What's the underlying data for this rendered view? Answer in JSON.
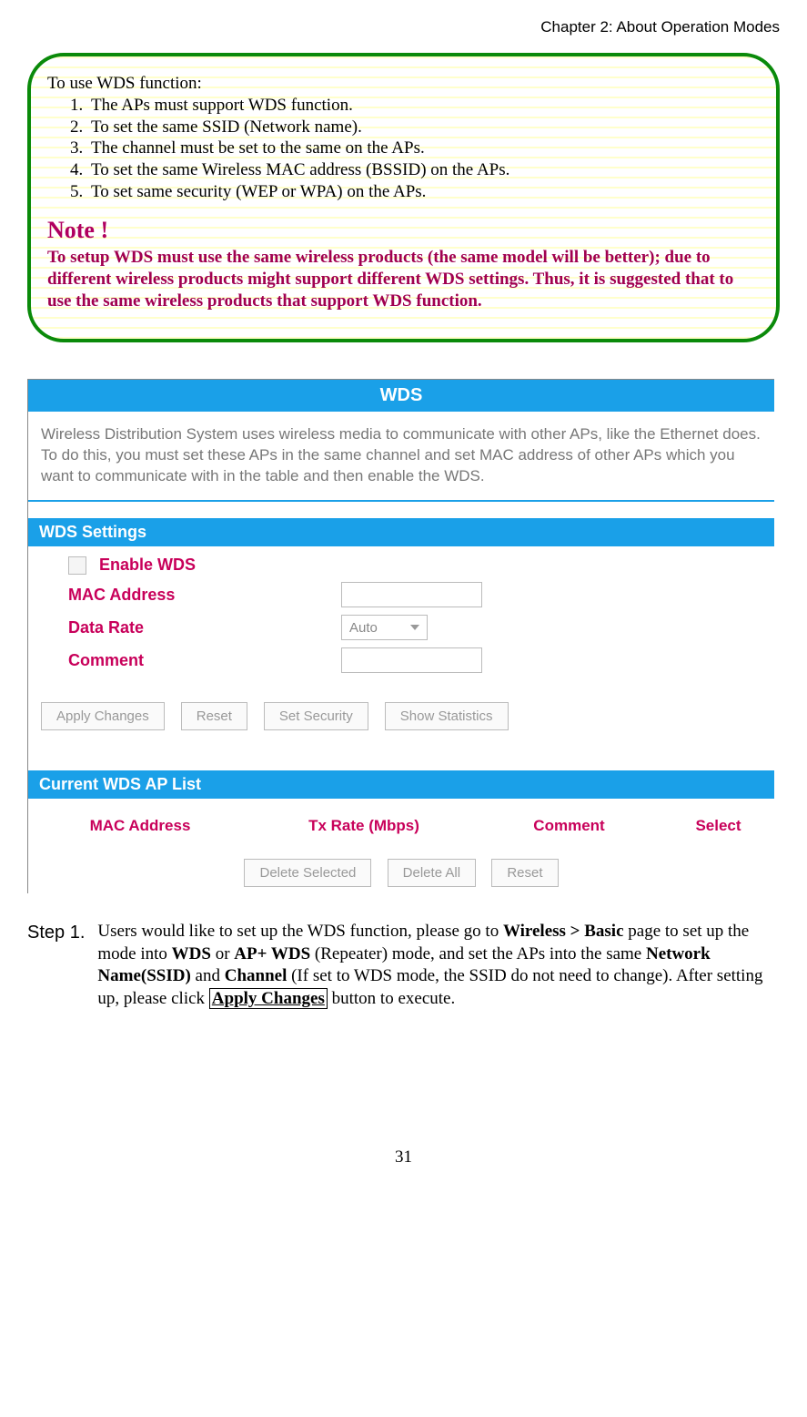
{
  "header": {
    "chapter": "Chapter 2: About Operation Modes"
  },
  "callout": {
    "intro": "To use WDS function:",
    "items": [
      "The APs must support WDS function.",
      "To set the same SSID (Network name).",
      "The channel  must be set to the same on the APs.",
      "To set the same Wireless MAC address (BSSID) on the APs.",
      "To set same security (WEP or WPA) on the APs."
    ],
    "note_title": "Note !",
    "note_body": "To setup WDS must use the same wireless products (the same model will be better); due to different wireless products might support different WDS settings. Thus, it is suggested that to use the same wireless products that support WDS function."
  },
  "screenshot": {
    "title_bar": "WDS",
    "description": "Wireless Distribution System uses wireless media to communicate with other APs, like the Ethernet does. To do this, you must set these APs in the same channel and set MAC address of other APs which you want to communicate with in the table and then enable the WDS.",
    "settings_title": "WDS Settings",
    "enable_label": "Enable WDS",
    "mac_label": "MAC Address",
    "rate_label": "Data Rate",
    "rate_value": "Auto",
    "comment_label": "Comment",
    "buttons": {
      "apply": "Apply Changes",
      "reset": "Reset",
      "security": "Set Security",
      "stats": "Show Statistics"
    },
    "list_title": "Current WDS AP List",
    "columns": {
      "mac": "MAC Address",
      "tx": "Tx Rate (Mbps)",
      "comment": "Comment",
      "select": "Select"
    },
    "list_buttons": {
      "del_sel": "Delete Selected",
      "del_all": "Delete All",
      "reset": "Reset"
    }
  },
  "step": {
    "label": "Step 1.",
    "t1": "Users would like to set up the WDS function, please go to ",
    "b1": "Wireless > Basic",
    "t2": " page to set up the mode into ",
    "b2": "WDS",
    "t3": " or ",
    "b3": "AP+ WDS",
    "t4": " (Repeater) mode, and set the APs into the same ",
    "b4": "Network Name(SSID)",
    "t5": " and ",
    "b5": "Channel",
    "t6": " (If set to WDS mode, the SSID do not need to change). After setting up, please click ",
    "box": "Apply Changes",
    "t7": " button to execute."
  },
  "page_number": "31"
}
